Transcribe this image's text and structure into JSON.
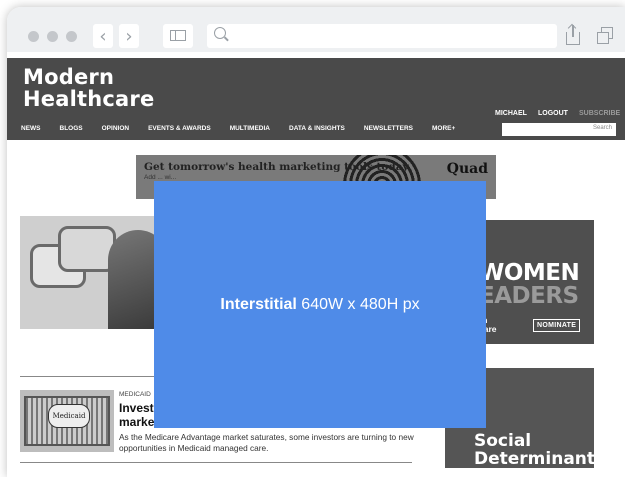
{
  "browser": {
    "back_glyph": "‹",
    "forward_glyph": "›"
  },
  "site": {
    "logo_line1": "Modern",
    "logo_line2": "Healthcare",
    "user_links": [
      "MICHAEL",
      "LOGOUT",
      "SUBSCRIBE"
    ],
    "search_placeholder": "Search",
    "nav_items": [
      "NEWS",
      "BLOGS",
      "OPINION",
      "EVENTS & AWARDS",
      "MULTIMEDIA",
      "DATA & INSIGHTS",
      "NEWSLETTERS",
      "MORE+"
    ]
  },
  "banner_ad": {
    "headline": "Get tomorrow's health marketing tools today",
    "subtext": "Add ... wi...",
    "brand": "Quad"
  },
  "right_ad": {
    "line1": "WOMEN",
    "line2": "EADERS",
    "brand_fragment_1": "rn",
    "brand_fragment_2": "care",
    "cta": "NOMINATE"
  },
  "right_ad2": {
    "line1": "Social",
    "line2": "Determinants"
  },
  "article": {
    "category": "MEDICAID",
    "headline_line1": "Investe",
    "headline_line2": "market",
    "summary": "As the Medicare Advantage market saturates, some investors are turning to new opportunities in Medicaid managed care.",
    "thumb_text": "Medicaid"
  },
  "interstitial": {
    "bold": "Interstitial",
    "rest": " 640W x 480H px"
  }
}
